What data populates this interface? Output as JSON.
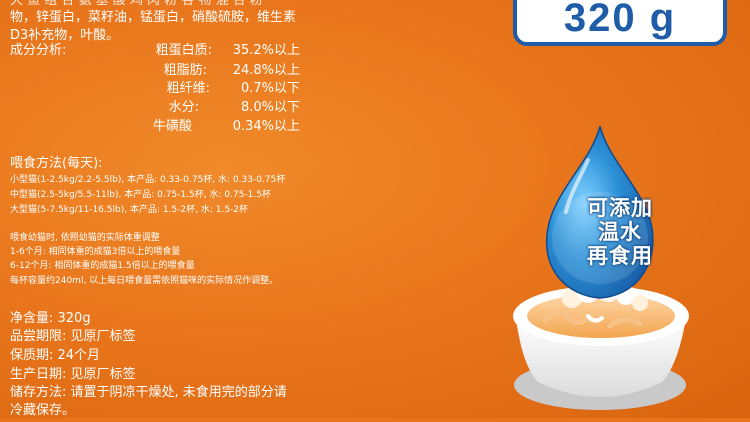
{
  "weight": "320 g",
  "ingredients_tail": {
    "line1": "物，锌蛋白，菜籽油，锰蛋白，硝酸硫胺，维生素",
    "line2": "D3补充物，叶酸。"
  },
  "analysis": {
    "label": "成分分析:",
    "rows": [
      {
        "name": "粗蛋白质:",
        "value": "35.2%以上"
      },
      {
        "name": "粗脂肪:",
        "value": "24.8%以上"
      },
      {
        "name": "粗纤维:",
        "value": "0.7%以下"
      },
      {
        "name": "水分:",
        "value": "8.0%以下"
      },
      {
        "name": "牛磺酸",
        "value": "0.34%以上"
      }
    ]
  },
  "feeding": {
    "title": "喂食方法(每天):",
    "rows": [
      "小型猫(1-2.5kg/2.2-5.5lb), 本产品: 0.33-0.75杯, 水: 0.33-0.75杯",
      "中型猫(2.5-5kg/5.5-11lb), 本产品: 0.75-1.5杯, 水: 0.75-1.5杯",
      "大型猫(5-7.5kg/11-16.5lb), 本产品: 1.5-2杯, 水: 1.5-2杯"
    ]
  },
  "kitten": {
    "lines": [
      "喂食幼猫时, 依照幼猫的实际体重调整",
      "1-6个月: 相同体重的成猫3倍以上的喂食量",
      "6-12个月: 相同体重的成猫1.5倍以上的喂食量",
      "每杯容量约240ml, 以上每日喂食量需依照猫咪的实际情况作调整。"
    ]
  },
  "product_info": {
    "lines": [
      "净含量: 320g",
      "品尝期限: 见原厂标签",
      "保质期: 24个月",
      "生产日期: 见原厂标签",
      "储存方法: 请置于阴凉干燥处, 未食用完的部分请",
      "冷藏保存。"
    ]
  },
  "drop_label": {
    "line1": "可添加",
    "line2": "温水",
    "line3": "再食用"
  },
  "colors": {
    "background": "#e9731a",
    "badge_border": "#1f5da8",
    "drop": "#2b8fd6",
    "bowl": "#ffffff"
  }
}
